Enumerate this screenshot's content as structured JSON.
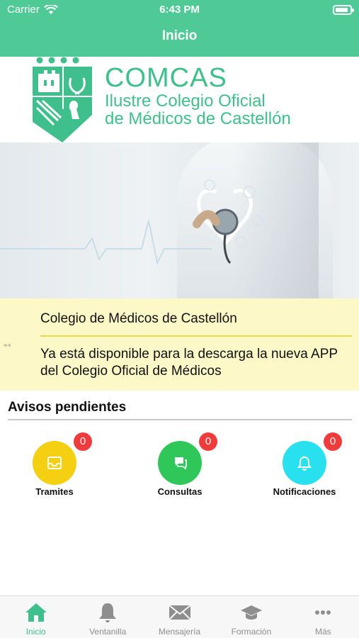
{
  "status_bar": {
    "carrier": "Carrier",
    "time": "6:43 PM"
  },
  "nav": {
    "title": "Inicio"
  },
  "header": {
    "brand": "COMCAS",
    "subtitle_line1": "Ilustre Colegio Oficial",
    "subtitle_line2": "de Médicos de Castellón"
  },
  "notice": {
    "title": "Colegio de Médicos de Castellón",
    "text": "Ya está disponible para la descarga la nueva APP del Colegio Oficial de Médicos"
  },
  "avisos": {
    "title": "Avisos pendientes",
    "items": [
      {
        "label": "Tramites",
        "count": "0",
        "color": "#f5cf12",
        "icon": "inbox-icon"
      },
      {
        "label": "Consultas",
        "count": "0",
        "color": "#2fc65a",
        "icon": "chat-icon"
      },
      {
        "label": "Notificaciones",
        "count": "0",
        "color": "#29e0ee",
        "icon": "bell-icon"
      }
    ]
  },
  "tabbar": {
    "items": [
      {
        "label": "Inicio",
        "icon": "home-icon",
        "active": true
      },
      {
        "label": "Ventanilla",
        "icon": "bell-icon",
        "active": false
      },
      {
        "label": "Mensajería",
        "icon": "envelope-icon",
        "active": false
      },
      {
        "label": "Formación",
        "icon": "graduation-cap-icon",
        "active": false
      },
      {
        "label": "Más",
        "icon": "more-icon",
        "active": false
      }
    ]
  },
  "colors": {
    "primary": "#4fc996",
    "brand_text": "#3fbf8c",
    "notice_bg": "#fdf8c7",
    "badge": "#ef3b3b"
  }
}
